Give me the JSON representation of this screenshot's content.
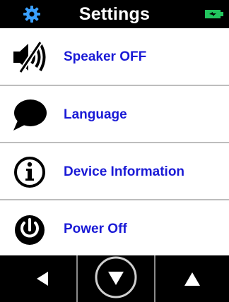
{
  "header": {
    "title": "Settings",
    "left_icon": "gear-icon",
    "right_icon": "battery-charging-icon"
  },
  "menu": {
    "items": [
      {
        "label": "Speaker OFF",
        "icon": "speaker-muted-icon"
      },
      {
        "label": "Language",
        "icon": "speech-bubble-icon"
      },
      {
        "label": "Device Information",
        "icon": "info-icon"
      },
      {
        "label": "Power Off",
        "icon": "power-icon"
      }
    ]
  },
  "footer": {
    "buttons": [
      {
        "name": "back-button",
        "icon": "triangle-left-icon"
      },
      {
        "name": "down-button",
        "icon": "circle-triangle-down-icon"
      },
      {
        "name": "up-button",
        "icon": "triangle-up-icon"
      }
    ]
  },
  "colors": {
    "header_bg": "#000000",
    "label_text": "#1a1ad6",
    "gear_icon": "#3aa0ff",
    "battery": "#22c55e",
    "divider": "#bdbdbd"
  }
}
